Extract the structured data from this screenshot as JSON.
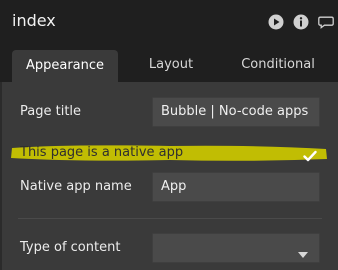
{
  "header": {
    "title": "index",
    "icons": [
      "play-icon",
      "info-icon",
      "comment-icon"
    ]
  },
  "tabs": [
    {
      "label": "Appearance",
      "active": true
    },
    {
      "label": "Layout",
      "active": false
    },
    {
      "label": "Conditional",
      "active": false
    }
  ],
  "form": {
    "page_title": {
      "label": "Page title",
      "value": "Bubble | No-code apps"
    },
    "native_app": {
      "label": "This page is a native app",
      "checked": true
    },
    "native_app_name": {
      "label": "Native app name",
      "value": "App"
    },
    "type_of_content": {
      "label": "Type of content",
      "value": ""
    }
  },
  "colors": {
    "header_bg": "#1f1f1f",
    "panel_bg": "#3a3a3a",
    "field_bg": "#4a4a4a",
    "highlight": "#c8c400"
  }
}
